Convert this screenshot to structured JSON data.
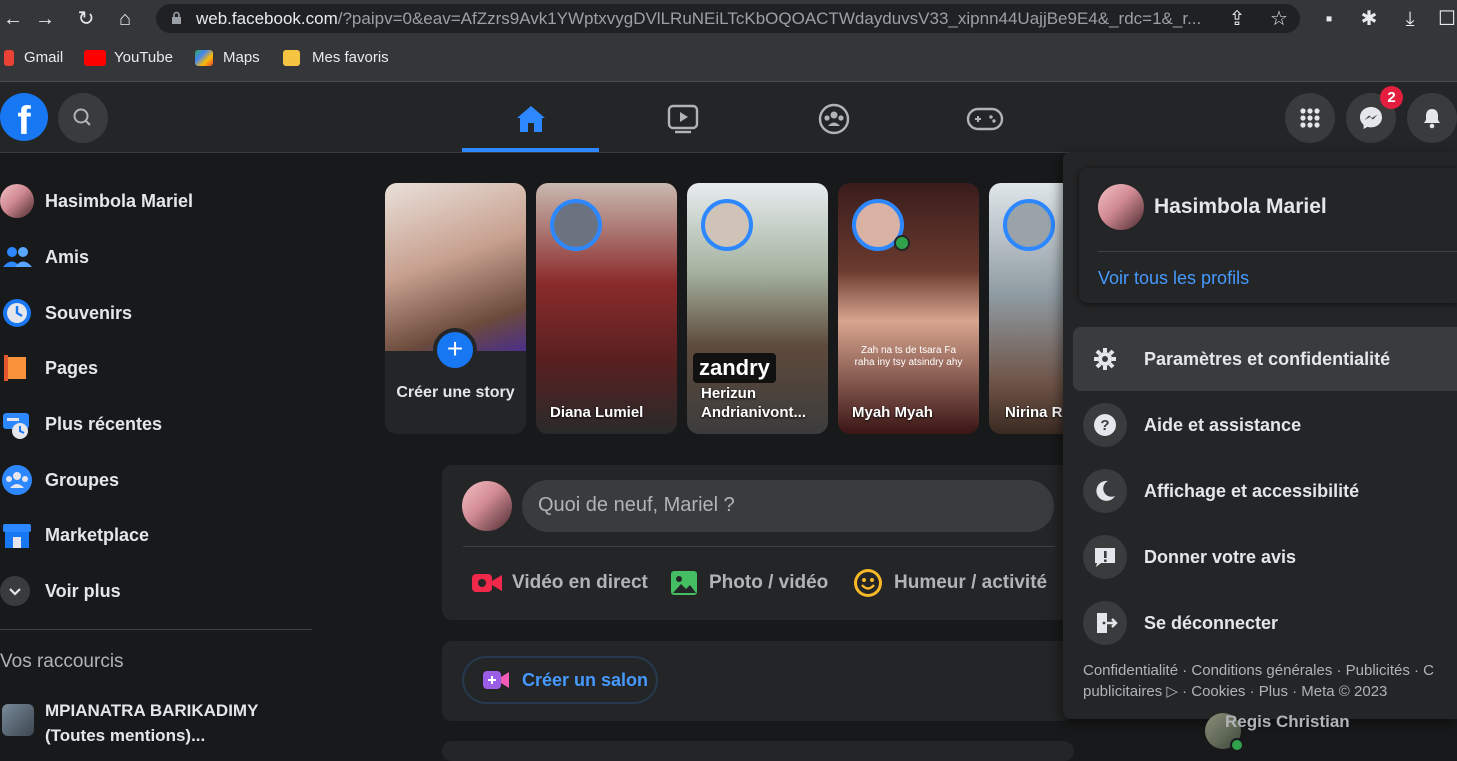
{
  "browser": {
    "url_host": "web.facebook.com",
    "url_rest": "/?paipv=0&eav=AfZzrs9Avk1YWptxvygDVlLRuNEiLTcKbOQOACTWdayduvsV33_xipnn44UajjBe9E4&_rdc=1&_r...",
    "bookmarks": [
      "Gmail",
      "YouTube",
      "Maps",
      "Mes favoris"
    ]
  },
  "topbar": {
    "logo": "f",
    "messenger_badge": "2"
  },
  "sidebar": {
    "items": [
      {
        "label": "Hasimbola Mariel",
        "icon": "avatar"
      },
      {
        "label": "Amis",
        "icon": "friends-icon"
      },
      {
        "label": "Souvenirs",
        "icon": "memories-icon"
      },
      {
        "label": "Pages",
        "icon": "pages-icon"
      },
      {
        "label": "Plus récentes",
        "icon": "recent-icon"
      },
      {
        "label": "Groupes",
        "icon": "groups-icon"
      },
      {
        "label": "Marketplace",
        "icon": "marketplace-icon"
      },
      {
        "label": "Voir plus",
        "icon": "chevron-down-icon"
      }
    ],
    "shortcuts_title": "Vos raccourcis",
    "shortcut_label": "MPIANATRA BARIKADIMY (Toutes mentions)..."
  },
  "stories": {
    "create_label": "Créer une story",
    "items": [
      {
        "name": "Diana Lumiel"
      },
      {
        "name": "Herizun Andrianivont...",
        "overlay": "zandry"
      },
      {
        "name": "Myah Myah",
        "overlay": "Zah na ts de tsara Fa raha iny tsy atsindry ahy"
      },
      {
        "name": "Nirina R"
      }
    ]
  },
  "composer": {
    "placeholder": "Quoi de neuf, Mariel ?",
    "actions": [
      "Vidéo en direct",
      "Photo / vidéo",
      "Humeur / activité"
    ],
    "room_label": "Créer un salon"
  },
  "account_menu": {
    "name": "Hasimbola Mariel",
    "see_profiles": "Voir tous les profils",
    "items": [
      {
        "label": "Paramètres et confidentialité",
        "icon": "gear-icon"
      },
      {
        "label": "Aide et assistance",
        "icon": "help-icon"
      },
      {
        "label": "Affichage et accessibilité",
        "icon": "moon-icon"
      },
      {
        "label": "Donner votre avis",
        "icon": "feedback-icon"
      },
      {
        "label": "Se déconnecter",
        "icon": "logout-icon"
      }
    ],
    "footer_line1": "Confidentialité · Conditions générales · Publicités · C",
    "footer_line2": "publicitaires ▷ · Cookies · Plus · Meta © 2023"
  },
  "contacts": {
    "visible": "Regis Christian"
  }
}
